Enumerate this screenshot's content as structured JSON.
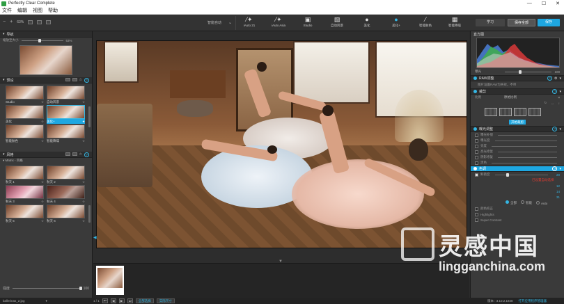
{
  "window": {
    "title": "Perfectly Clear Complete",
    "controls": [
      "—",
      "☐",
      "✕"
    ]
  },
  "menu": [
    "文件",
    "编辑",
    "视图",
    "帮助"
  ],
  "toolbar": {
    "zoom_minus": "−",
    "zoom_plus": "+",
    "zoom_value": "63%",
    "preset_dropdown": "智能自动",
    "items": [
      {
        "label": "iAuto 21",
        "icon": "magic-wand-icon"
      },
      {
        "label": "iAuto Asia",
        "icon": "magic-wand-icon"
      },
      {
        "label": "Studio",
        "icon": "photo-icon"
      },
      {
        "label": "自动风景",
        "icon": "landscape-icon"
      },
      {
        "label": "美化",
        "icon": "balloon-icon"
      },
      {
        "label": "美化+",
        "icon": "balloon-plus-icon"
      },
      {
        "label": "智能肤色",
        "icon": "brush-icon"
      },
      {
        "label": "智能降噪",
        "icon": "noise-icon"
      }
    ],
    "active_index": 5,
    "learn": "学习",
    "save_all": "保存全部",
    "export": "保存"
  },
  "left": {
    "navigator": {
      "title": "导航",
      "zoom_label": "缩放至大小",
      "zoom_value": "63%",
      "zoom_level": 0.63
    },
    "presets": {
      "title": "预设",
      "items": [
        {
          "label": "Studio",
          "star": "☆"
        },
        {
          "label": "自动风景",
          "star": "☆"
        },
        {
          "label": "美化",
          "star": "☆"
        },
        {
          "label": "美化+",
          "star": "★"
        },
        {
          "label": "智能肤色",
          "star": "☆"
        },
        {
          "label": "智能降噪",
          "star": "☆"
        }
      ],
      "selected_index": 3
    },
    "looks": {
      "title": "风格",
      "category": "Matrix - 风格",
      "items": [
        {
          "label": "秋天 1",
          "star": "☆"
        },
        {
          "label": "秋天 2",
          "star": "☆"
        },
        {
          "label": "秋天 3",
          "star": "☆"
        },
        {
          "label": "秋天 4",
          "star": "☆"
        },
        {
          "label": "秋天 5",
          "star": "☆"
        },
        {
          "label": "秋天 6",
          "star": "☆"
        }
      ]
    },
    "strength": {
      "label": "强度",
      "value": "100",
      "level": 1.0
    }
  },
  "bottom": {
    "filename": "ballerinas_2.jpg",
    "counter": "1 / 1",
    "select_all": "全部选择",
    "actual_size": "实际尺寸"
  },
  "right": {
    "histogram_title": "直方图",
    "exposure_label": "曝光",
    "exposure_value": "100",
    "sections": {
      "raw": {
        "title": "RAW调整",
        "note": "图片设置RAW为失效，不带"
      },
      "crop": {
        "title": "裁剪",
        "aspect_label": "比例",
        "aspect_value": "原始比例",
        "start": "开始裁剪"
      },
      "exposure": {
        "title": "曝光调整",
        "rows": [
          {
            "label": "曝光补偿",
            "value": ""
          },
          {
            "label": "曝光度",
            "value": ""
          },
          {
            "label": "亮度",
            "value": ""
          },
          {
            "label": "高光修复",
            "value": ""
          },
          {
            "label": "阴影修复",
            "value": ""
          },
          {
            "label": "黑色",
            "value": ""
          }
        ]
      },
      "color": {
        "title": "色调",
        "rows": [
          {
            "label": "鲜艳度",
            "value": "20",
            "checked": true
          }
        ],
        "red_note": "已设置自动选择"
      }
    },
    "modes": [
      "全部",
      "智能",
      "Auto"
    ],
    "mode_selected": 0,
    "extra_rows": [
      {
        "label": "颜色校正",
        "checked": false
      },
      {
        "label": "Highlights",
        "checked": false
      },
      {
        "label": "Super Contrast",
        "checked": false
      }
    ],
    "values_right": [
      "12",
      "14",
      "31"
    ],
    "status_version": "版本 : 3.10.2.1848",
    "status_link": "打开应用程序管理器"
  },
  "watermark": {
    "cn": "灵感中国",
    "en": "lingganchina.com"
  },
  "colors": {
    "accent": "#1ea7e1",
    "panel": "#3a3a3a",
    "header": "#2d2d2d",
    "alert": "#e03c31"
  }
}
